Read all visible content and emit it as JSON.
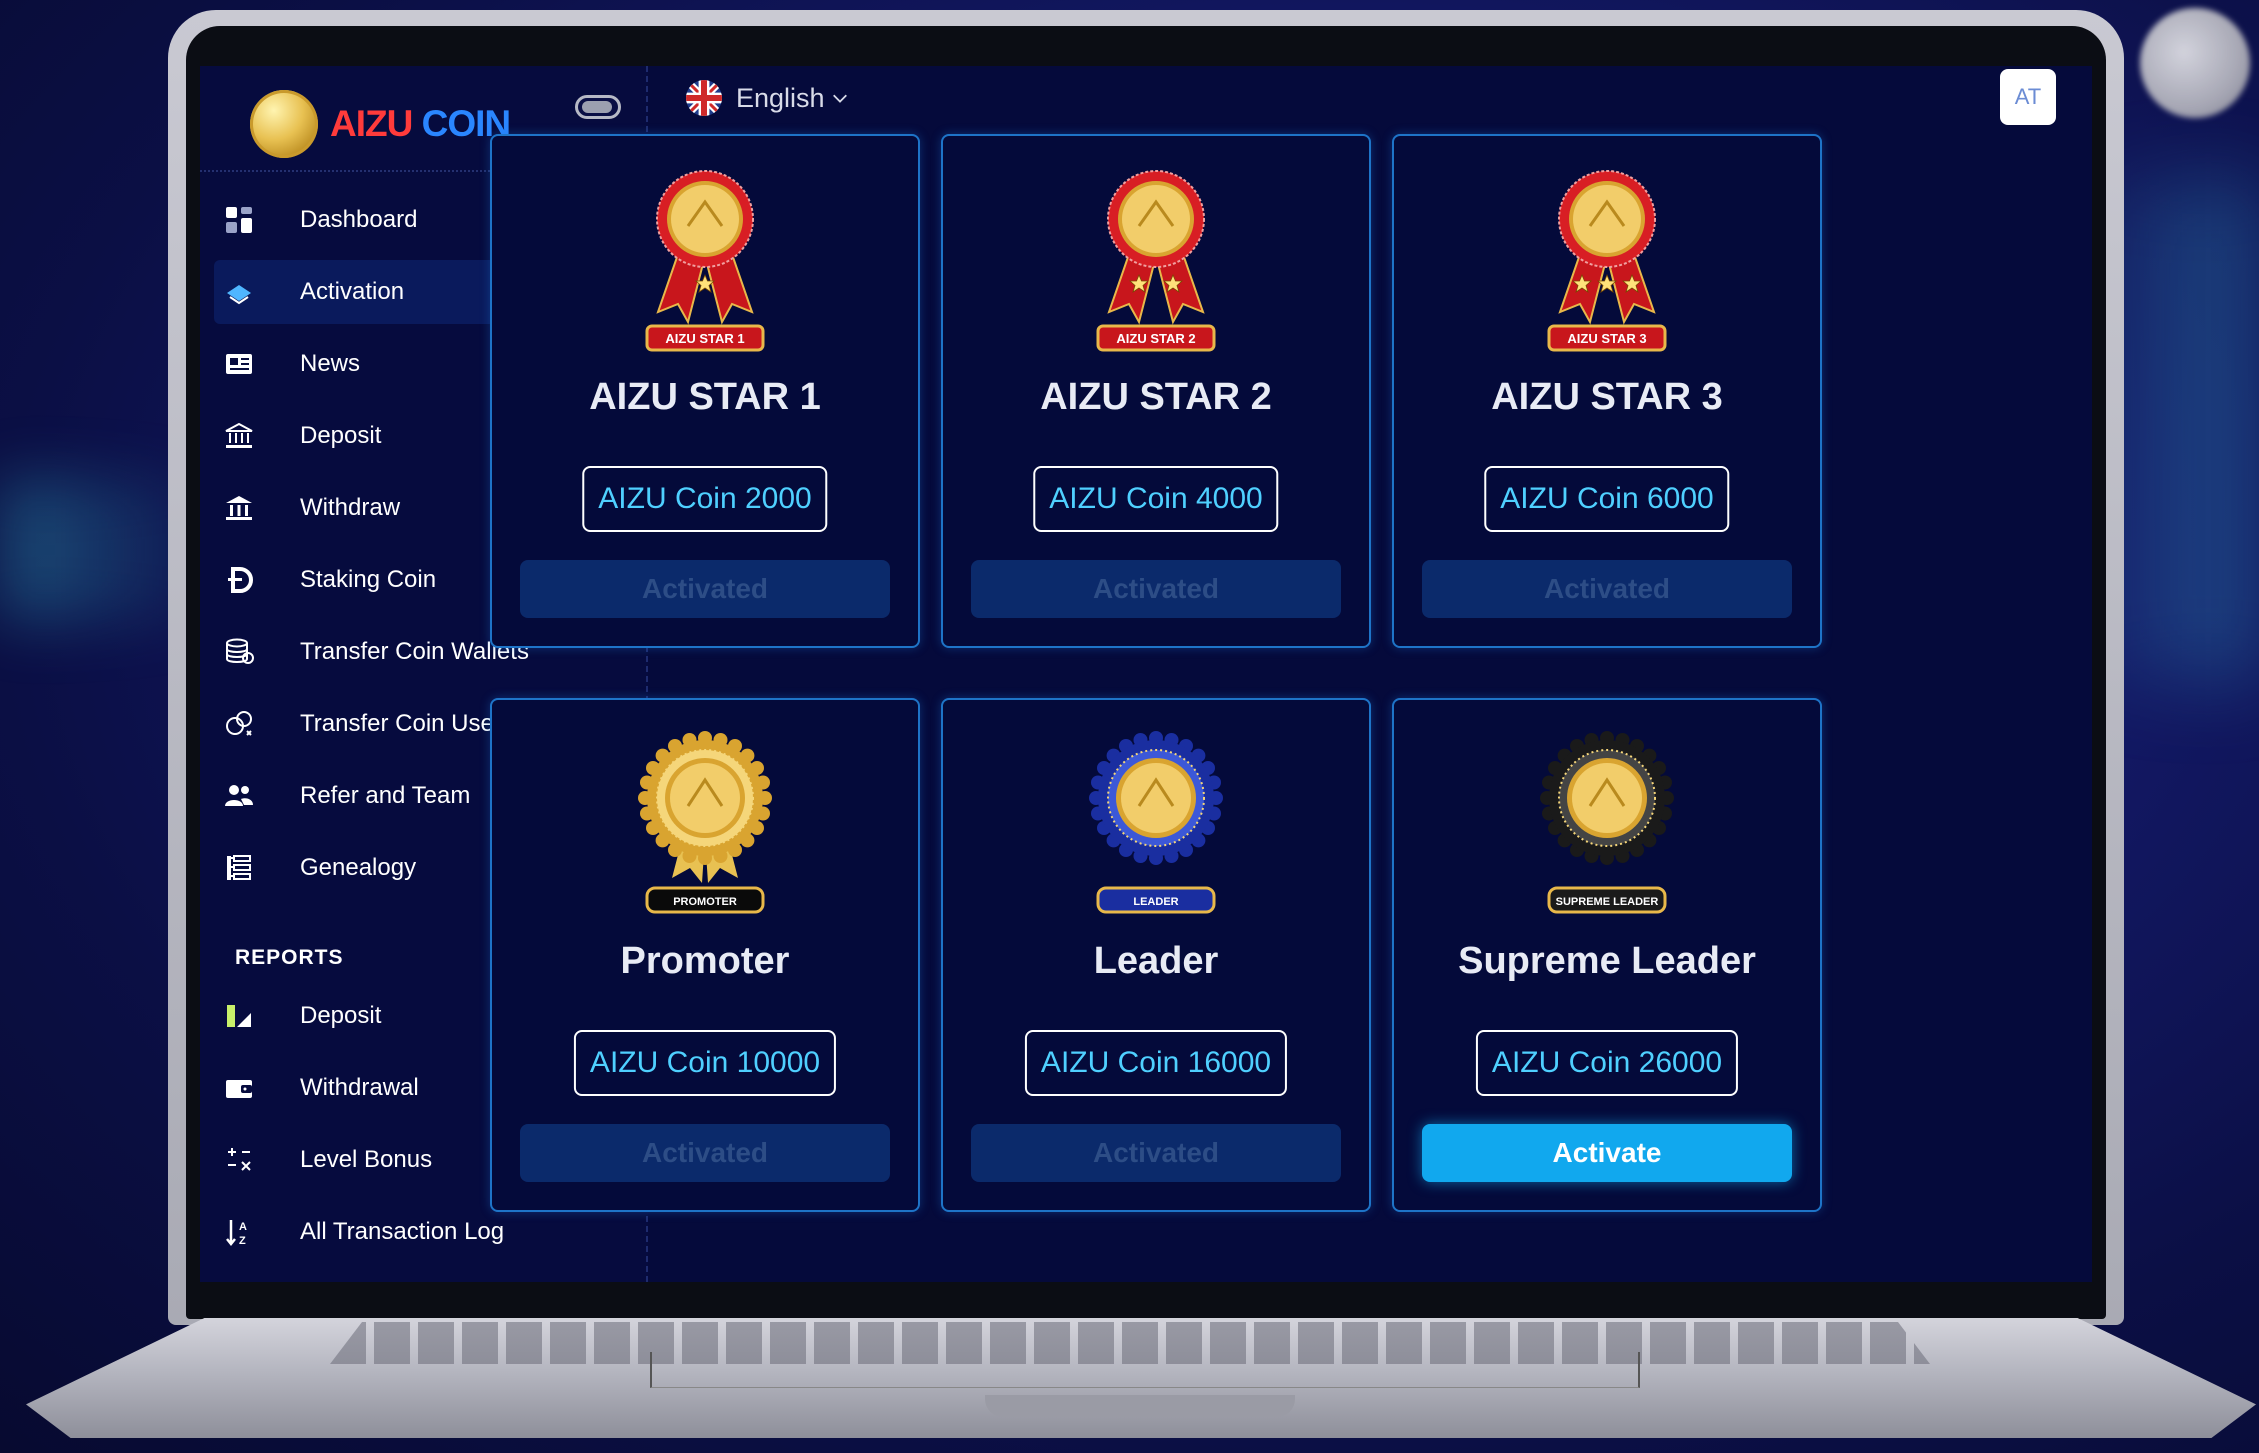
{
  "app": {
    "logo_part1": "AIZU",
    "logo_part2": "COIN"
  },
  "topbar": {
    "language": "English",
    "avatar_initials": "AT"
  },
  "sidebar": {
    "items": [
      {
        "label": "Dashboard",
        "icon": "dashboard-icon"
      },
      {
        "label": "Activation",
        "icon": "activation-icon"
      },
      {
        "label": "News",
        "icon": "news-icon"
      },
      {
        "label": "Deposit",
        "icon": "bank-icon"
      },
      {
        "label": "Withdraw",
        "icon": "withdraw-icon"
      },
      {
        "label": "Staking Coin",
        "icon": "staking-icon"
      },
      {
        "label": "Transfer Coin Wallets",
        "icon": "coins-stack-icon"
      },
      {
        "label": "Transfer Coin User",
        "icon": "transfer-user-icon"
      },
      {
        "label": "Refer and Team",
        "icon": "team-icon"
      },
      {
        "label": "Genealogy",
        "icon": "genealogy-icon"
      }
    ],
    "reports_title": "REPORTS",
    "reports": [
      {
        "label": "Deposit",
        "icon": "deposit-report-icon"
      },
      {
        "label": "Withdrawal",
        "icon": "wallet-icon"
      },
      {
        "label": "Level Bonus",
        "icon": "calculator-icon"
      },
      {
        "label": "All Transaction Log",
        "icon": "sort-icon"
      }
    ]
  },
  "cards": [
    {
      "title": "AIZU STAR 1",
      "ribbon": "AIZU STAR 1",
      "price": "AIZU Coin 2000",
      "button": "Activated",
      "active": false
    },
    {
      "title": "AIZU STAR 2",
      "ribbon": "AIZU STAR 2",
      "price": "AIZU Coin 4000",
      "button": "Activated",
      "active": false
    },
    {
      "title": "AIZU STAR 3",
      "ribbon": "AIZU STAR 3",
      "price": "AIZU Coin 6000",
      "button": "Activated",
      "active": false
    },
    {
      "title": "Promoter",
      "ribbon": "PROMOTER",
      "price": "AIZU Coin 10000",
      "button": "Activated",
      "active": false
    },
    {
      "title": "Leader",
      "ribbon": "LEADER",
      "price": "AIZU Coin 16000",
      "button": "Activated",
      "active": false
    },
    {
      "title": "Supreme Leader",
      "ribbon": "SUPREME LEADER",
      "price": "AIZU Coin 26000",
      "button": "Activate",
      "active": true
    }
  ],
  "colors": {
    "accent": "#11a8ee",
    "card_border": "#1e74c8",
    "price_text": "#4fd0ff",
    "logo_red": "#ff3b3b",
    "logo_blue": "#2a86ff"
  }
}
